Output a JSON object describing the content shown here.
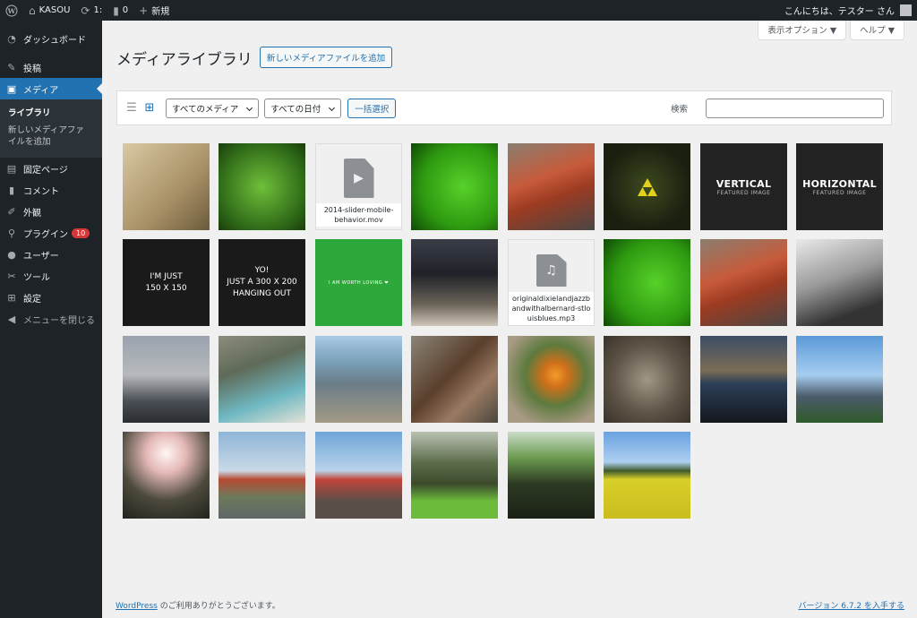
{
  "admin_bar": {
    "site_name": "KASOU",
    "updates_count": "1:",
    "comments_count": "0",
    "new_label": "新規",
    "greeting": "こんにちは、テスター さん"
  },
  "sidebar": {
    "items": [
      {
        "label": "ダッシュボード",
        "icon": "dashboard-icon"
      },
      {
        "label": "投稿",
        "icon": "pin-icon"
      },
      {
        "label": "メディア",
        "icon": "media-icon"
      },
      {
        "label": "固定ページ",
        "icon": "page-icon"
      },
      {
        "label": "コメント",
        "icon": "comment-icon"
      },
      {
        "label": "外観",
        "icon": "appearance-icon"
      },
      {
        "label": "プラグイン",
        "icon": "plugin-icon",
        "badge": "10"
      },
      {
        "label": "ユーザー",
        "icon": "user-icon"
      },
      {
        "label": "ツール",
        "icon": "tools-icon"
      },
      {
        "label": "設定",
        "icon": "settings-icon"
      }
    ],
    "submenu": {
      "library": "ライブラリ",
      "add_new": "新しいメディアファイルを追加"
    },
    "collapse_label": "メニューを閉じる"
  },
  "screen_meta": {
    "screen_options": "表示オプション ▼",
    "help": "ヘルプ ▼"
  },
  "main": {
    "title": "メディアライブラリ",
    "add_new": "新しいメディアファイルを追加",
    "filter_type": "すべてのメディア",
    "filter_date": "すべての日付",
    "bulk_select": "一括選択",
    "search_label": "検索"
  },
  "tiles": {
    "video_name": "2014-slider-mobile-behavior.mov",
    "audio_name": "originaldixielandjazzbandwithalbernard-stlouisblues.mp3",
    "vertical_title": "VERTICAL",
    "vertical_sub": "FEATURED IMAGE",
    "horizontal_title": "HORIZONTAL",
    "horizontal_sub": "FEATURED IMAGE",
    "just150": "I'M JUST\n150 X 150",
    "yo_text": "YO!\nJUST A 300 X 200\nHANGING OUT",
    "worth_loving": "I AM WORTH LOVING ❤"
  },
  "footer": {
    "wp_link": "WordPress",
    "thanks": " のご利用ありがとうございます。",
    "version": "バージョン 6.7.2 を入手する"
  }
}
